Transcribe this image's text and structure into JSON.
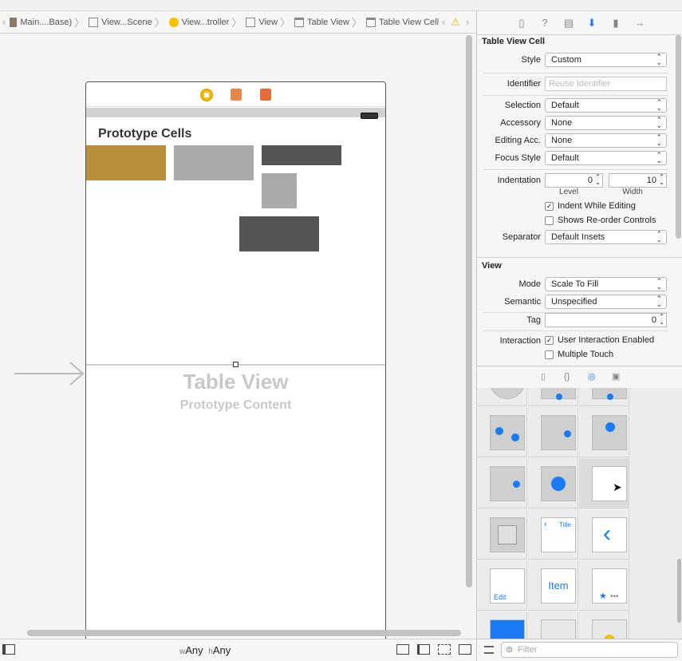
{
  "breadcrumbs": [
    "Main....Base)",
    "View...Scene",
    "View...troller",
    "View",
    "Table View",
    "Table View Cell"
  ],
  "canvas": {
    "prototype_cells_title": "Prototype Cells",
    "table_view_title": "Table View",
    "table_view_subtitle": "Prototype Content",
    "size_class_w_prefix": "w",
    "size_class_w_value": "Any",
    "size_class_h_prefix": "h",
    "size_class_h_value": "Any",
    "colors": {
      "gold": "#b8903d",
      "light_gray": "#aaaaaa",
      "dark_gray": "#555555"
    }
  },
  "inspector": {
    "cell_section": {
      "title": "Table View Cell",
      "style_label": "Style",
      "style_value": "Custom",
      "identifier_label": "Identifier",
      "identifier_placeholder": "Reuse Identifier",
      "selection_label": "Selection",
      "selection_value": "Default",
      "accessory_label": "Accessory",
      "accessory_value": "None",
      "editing_acc_label": "Editing Acc.",
      "editing_acc_value": "None",
      "focus_style_label": "Focus Style",
      "focus_style_value": "Default",
      "indentation_label": "Indentation",
      "level_value": "0",
      "level_label": "Level",
      "width_value": "10",
      "width_label": "Width",
      "indent_while_editing": "Indent While Editing",
      "shows_reorder": "Shows Re-order Controls",
      "separator_label": "Separator",
      "separator_value": "Default Insets"
    },
    "view_section": {
      "title": "View",
      "mode_label": "Mode",
      "mode_value": "Scale To Fill",
      "semantic_label": "Semantic",
      "semantic_value": "Unspecified",
      "tag_label": "Tag",
      "tag_value": "0",
      "interaction_label": "Interaction",
      "user_interaction": "User Interaction Enabled",
      "multiple_touch": "Multiple Touch"
    },
    "tab_icons": [
      "file-icon",
      "help-icon",
      "identity-icon",
      "attributes-icon",
      "size-icon",
      "connections-icon"
    ]
  },
  "library": {
    "item_label": "Item",
    "title_label": "Title",
    "edit_label": "Edit",
    "filter_placeholder": "Filter"
  }
}
